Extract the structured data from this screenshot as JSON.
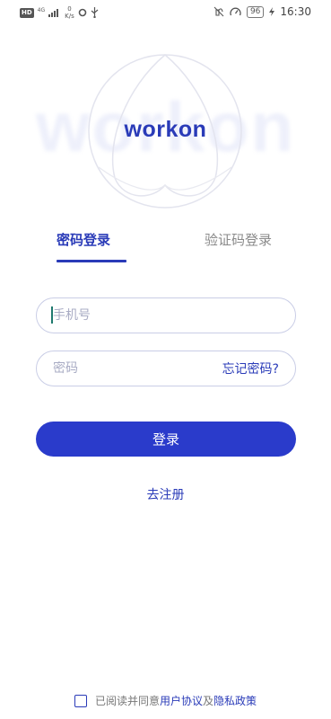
{
  "status_bar": {
    "hd": "HD",
    "network": "4G",
    "speed_value": "0",
    "speed_unit": "K/s",
    "battery": "96",
    "time": "16:30",
    "icons": [
      "hd-icon",
      "signal-icon",
      "circle-icon",
      "usb-icon",
      "mute-icon",
      "speed-icon",
      "battery-icon",
      "charging-icon"
    ]
  },
  "logo": {
    "text": "workon",
    "background_text": "workon",
    "color": "#2a3bb8"
  },
  "tabs": {
    "password_login": "密码登录",
    "code_login": "验证码登录",
    "active": "password_login"
  },
  "form": {
    "phone_placeholder": "手机号",
    "phone_value": "",
    "password_placeholder": "密码",
    "password_value": "",
    "forgot_password": "忘记密码?"
  },
  "login_button": "登录",
  "register_link": "去注册",
  "agreement": {
    "prefix": "已阅读并同意",
    "user_agreement": "用户协议",
    "and": "及",
    "privacy_policy": "隐私政策",
    "checked": false
  },
  "colors": {
    "accent": "#2a3bcb",
    "text_muted": "#8a8a8a",
    "border": "#c9cde6"
  }
}
